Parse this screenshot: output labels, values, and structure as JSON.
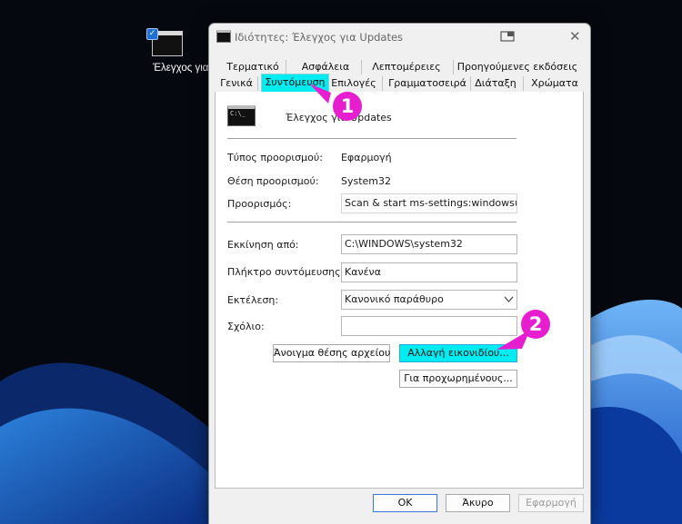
{
  "desktop": {
    "icon_label": "Έλεγχος για Updates"
  },
  "window": {
    "title": "Ιδιότητες: Έλεγχος για Updates"
  },
  "tabs": {
    "row1": [
      "Τερματικό",
      "Ασφάλεια",
      "Λεπτομέρειες",
      "Προηγούμενες εκδόσεις"
    ],
    "row2": [
      "Γενικά",
      "Συντόμευση",
      "Επιλογές",
      "Γραμματοσειρά",
      "Διάταξη",
      "Χρώματα"
    ],
    "active": "Συντόμευση"
  },
  "shortcut": {
    "name": "Έλεγχος για Updates",
    "icon_text": "C:\\_",
    "target_type_label": "Τύπος προορισμού:",
    "target_type_value": "Εφαρμογή",
    "target_location_label": "Θέση προορισμού:",
    "target_location_value": "System32",
    "target_label": "Προορισμός:",
    "target_value": "Scan & start ms-settings:windowsupdate",
    "start_in_label": "Εκκίνηση από:",
    "start_in_value": "C:\\WINDOWS\\system32",
    "hotkey_label": "Πλήκτρο συντόμευσης:",
    "hotkey_value": "Κανένα",
    "run_label": "Εκτέλεση:",
    "run_value": "Κανονικό παράθυρο",
    "comment_label": "Σχόλιο:",
    "comment_value": ""
  },
  "buttons": {
    "open_location": "Άνοιγμα θέσης αρχείου",
    "change_icon": "Αλλαγή εικονιδίου...",
    "advanced": "Για προχωρημένους...",
    "ok": "OK",
    "cancel": "Άκυρο",
    "apply": "Εφαρμογή"
  },
  "callouts": [
    "1",
    "2"
  ],
  "colors": {
    "highlight": "#00ecf1",
    "callout": "#e61ecf",
    "dialog_bg": "#f0f0f0",
    "desktop_bg": "#05080f"
  }
}
